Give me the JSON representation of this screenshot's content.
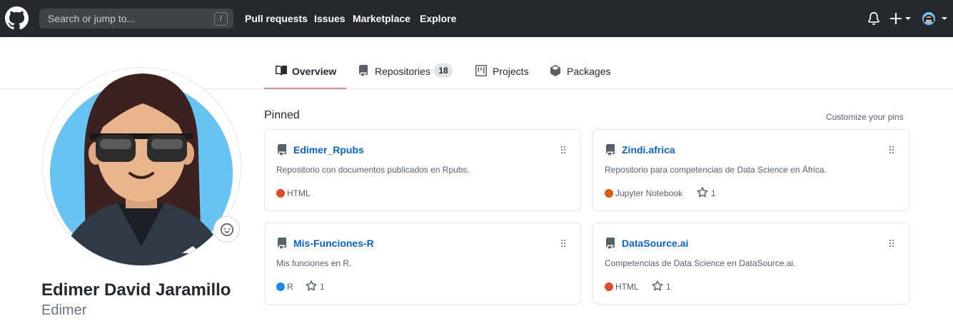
{
  "header": {
    "search_placeholder": "Search or jump to...",
    "search_shortcut": "/",
    "nav": [
      "Pull requests",
      "Issues",
      "Marketplace",
      "Explore"
    ]
  },
  "tabs": [
    {
      "label": "Overview",
      "icon": "book-icon",
      "selected": true
    },
    {
      "label": "Repositories",
      "icon": "repo-icon",
      "count": "18"
    },
    {
      "label": "Projects",
      "icon": "project-icon"
    },
    {
      "label": "Packages",
      "icon": "package-icon"
    }
  ],
  "profile": {
    "full_name": "Edimer David Jaramillo",
    "username": "Edimer"
  },
  "pinned": {
    "title": "Pinned",
    "customize_label": "Customize your pins",
    "repos": [
      {
        "name": "Edimer_Rpubs",
        "description": "Repositorio con documentos publicados en Rpubs.",
        "language": "HTML",
        "language_color": "#e34c26",
        "stars": ""
      },
      {
        "name": "Zindi.africa",
        "description": "Repositorio para competencias de Data Science en África.",
        "language": "Jupyter Notebook",
        "language_color": "#DA5B0B",
        "stars": "1"
      },
      {
        "name": "Mis-Funciones-R",
        "description": "Mis funciones en R.",
        "language": "R",
        "language_color": "#198CE7",
        "stars": "1"
      },
      {
        "name": "DataSource.ai",
        "description": "Competencias de Data Science en DataSource.ai.",
        "language": "HTML",
        "language_color": "#e34c26",
        "stars": "1"
      }
    ]
  },
  "colors": {
    "header_bg": "#24292e",
    "link": "#0366d6",
    "tab_underline": "#f9826c"
  }
}
